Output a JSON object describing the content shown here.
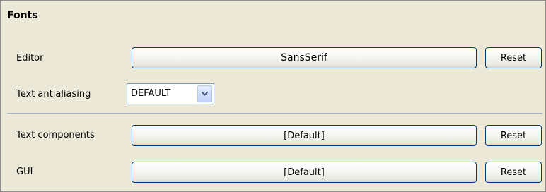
{
  "section": {
    "title": "Fonts"
  },
  "editor": {
    "label": "Editor",
    "font_value": "SansSerif",
    "reset_label": "Reset"
  },
  "antialiasing": {
    "label": "Text antialiasing",
    "selected": "DEFAULT",
    "arrow_icon": "chevron-down-icon"
  },
  "text_components": {
    "label": "Text components",
    "font_value": "[Default]",
    "reset_label": "Reset"
  },
  "gui": {
    "label": "GUI",
    "font_value": "[Default]",
    "reset_label": "Reset"
  },
  "colors": {
    "panel_background": "#ece9d8",
    "button_border": "#003c74",
    "divider": "#9fb5cc",
    "combo_border": "#7f9db9"
  }
}
